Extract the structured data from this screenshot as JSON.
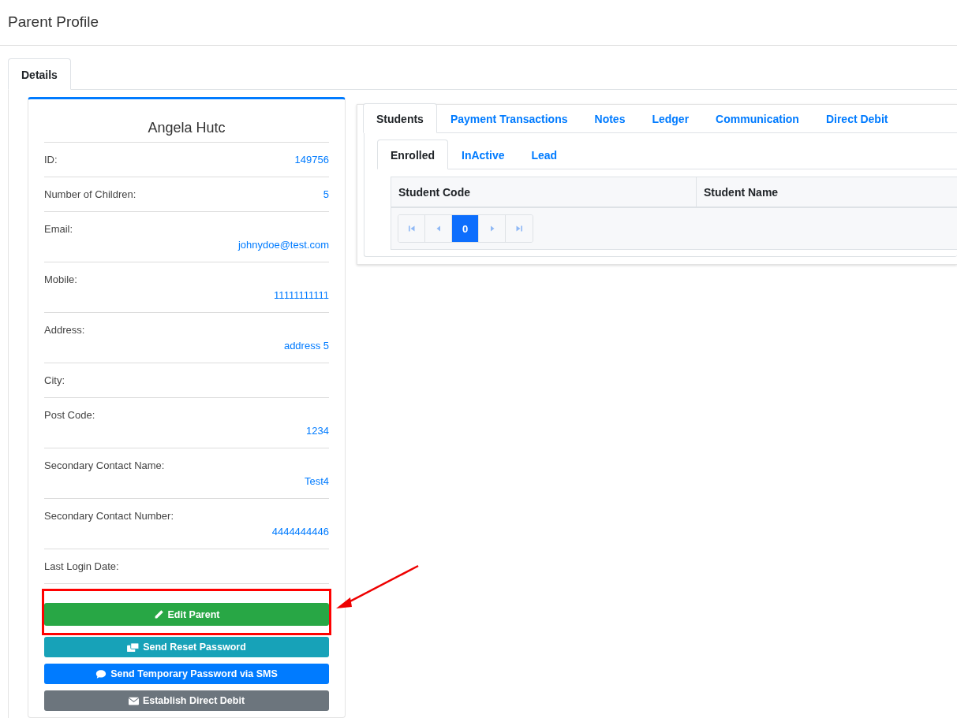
{
  "page_title": "Parent Profile",
  "page_tabs": [
    {
      "label": "Details",
      "selected": true
    }
  ],
  "profile": {
    "name": "Angela Hutc",
    "fields": [
      {
        "label": "ID:",
        "value": "149756",
        "kind": "inline"
      },
      {
        "label": "Number of Children:",
        "value": "5",
        "kind": "inline"
      },
      {
        "label": "Email:",
        "value": "johnydoe@test.com",
        "kind": "stacked"
      },
      {
        "label": "Mobile:",
        "value": "11111111111",
        "kind": "stacked"
      },
      {
        "label": "Address:",
        "value": "address 5",
        "kind": "stacked"
      },
      {
        "label": "City:",
        "kind": "inline"
      },
      {
        "label": "Post Code:",
        "value": "1234",
        "kind": "stacked"
      },
      {
        "label": "Secondary Contact Name:",
        "value": "Test4",
        "kind": "stacked"
      },
      {
        "label": "Secondary Contact Number:",
        "value": "4444444446",
        "kind": "stacked"
      },
      {
        "label": "Last Login Date:",
        "kind": "inline"
      }
    ],
    "buttons": [
      {
        "label": "Edit Parent",
        "kind": "edit",
        "highlighted": true
      },
      {
        "label": "Send Reset Password",
        "kind": "reset",
        "highlighted": false
      },
      {
        "label": "Send Temporary Password via SMS",
        "kind": "sms",
        "highlighted": false
      },
      {
        "label": "Establish Direct Debit",
        "kind": "debit",
        "highlighted": false
      }
    ]
  },
  "tabs": [
    {
      "label": "Students",
      "selected": true
    },
    {
      "label": "Payment Transactions",
      "selected": false
    },
    {
      "label": "Notes",
      "selected": false
    },
    {
      "label": "Ledger",
      "selected": false
    },
    {
      "label": "Communication",
      "selected": false
    },
    {
      "label": "Direct Debit",
      "selected": false
    }
  ],
  "student_tabs": [
    {
      "label": "Enrolled",
      "selected": true
    },
    {
      "label": "InActive",
      "selected": false
    },
    {
      "label": "Lead",
      "selected": false
    }
  ],
  "table": {
    "columns": [
      "Student Code",
      "Student Name"
    ]
  },
  "pager": {
    "pages": [
      {
        "label": "0",
        "selected": true
      }
    ]
  }
}
